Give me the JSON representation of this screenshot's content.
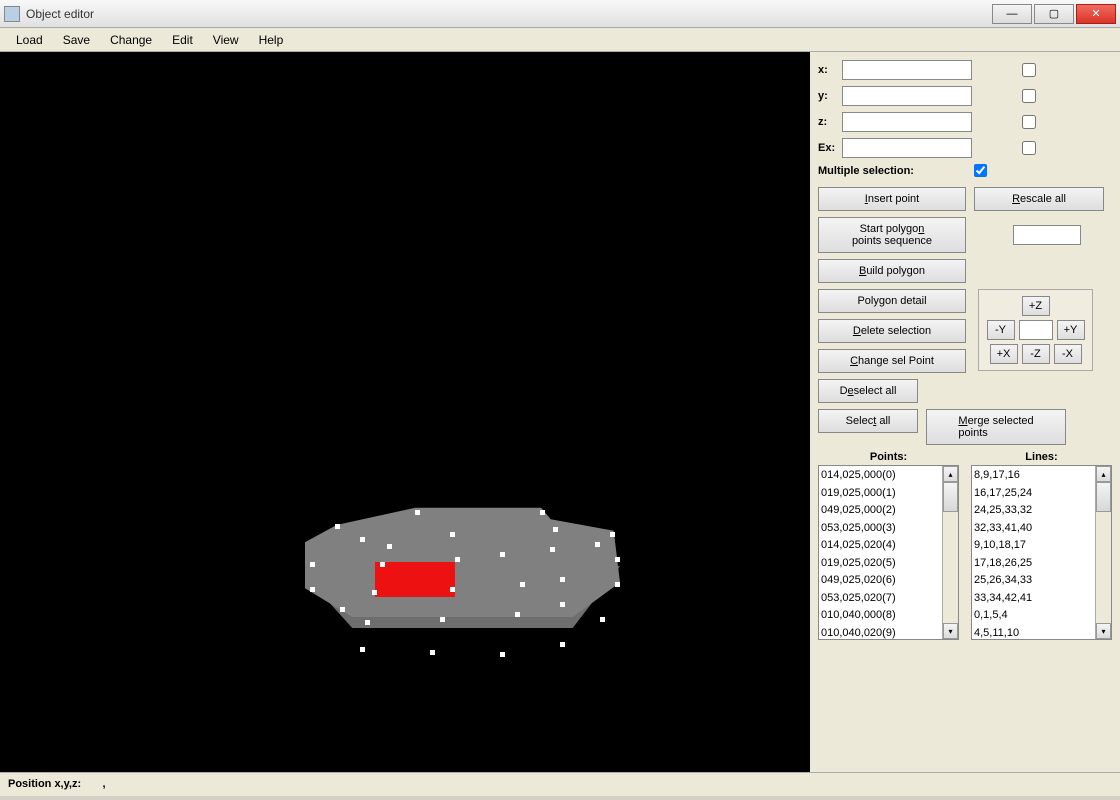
{
  "window": {
    "title": "Object editor"
  },
  "menu": {
    "load": "Load",
    "save": "Save",
    "change": "Change",
    "edit": "Edit",
    "view": "View",
    "help": "Help"
  },
  "fields": {
    "x_label": "x:",
    "x_value": "",
    "x_checked": false,
    "y_label": "y:",
    "y_value": "",
    "y_checked": false,
    "z_label": "z:",
    "z_value": "",
    "z_checked": false,
    "ex_label": "Ex:",
    "ex_value": "",
    "ex_checked": false,
    "multi_label": "Multiple selection:",
    "multi_checked": true
  },
  "buttons": {
    "insert_point": "Insert point",
    "rescale_all": "Rescale all",
    "start_poly": "Start polygon points sequence",
    "seq_value": "",
    "build_poly": "Build polygon",
    "poly_detail": "Polygon detail",
    "delete_sel": "Delete selection",
    "change_sel": "Change sel Point",
    "deselect_all": "Deselect all",
    "select_all": "Select all",
    "merge_sel": "Merge selected points"
  },
  "nav": {
    "pz": "+Z",
    "mz": "-Z",
    "py": "+Y",
    "my": "-Y",
    "px": "+X",
    "mx": "-X",
    "val": ""
  },
  "lists": {
    "points_header": "Points:",
    "lines_header": "Lines:",
    "points": [
      "014,025,000(0)",
      "019,025,000(1)",
      "049,025,000(2)",
      "053,025,000(3)",
      "014,025,020(4)",
      "019,025,020(5)",
      "049,025,020(6)",
      "053,025,020(7)",
      "010,040,000(8)",
      "010,040,020(9)"
    ],
    "lines": [
      "8,9,17,16",
      "16,17,25,24",
      "24,25,33,32",
      "32,33,41,40",
      "9,10,18,17",
      "17,18,26,25",
      "25,26,34,33",
      "33,34,42,41",
      "0,1,5,4",
      "4,5,11,10"
    ]
  },
  "status": {
    "label": "Position x,y,z:",
    "value": ","
  }
}
